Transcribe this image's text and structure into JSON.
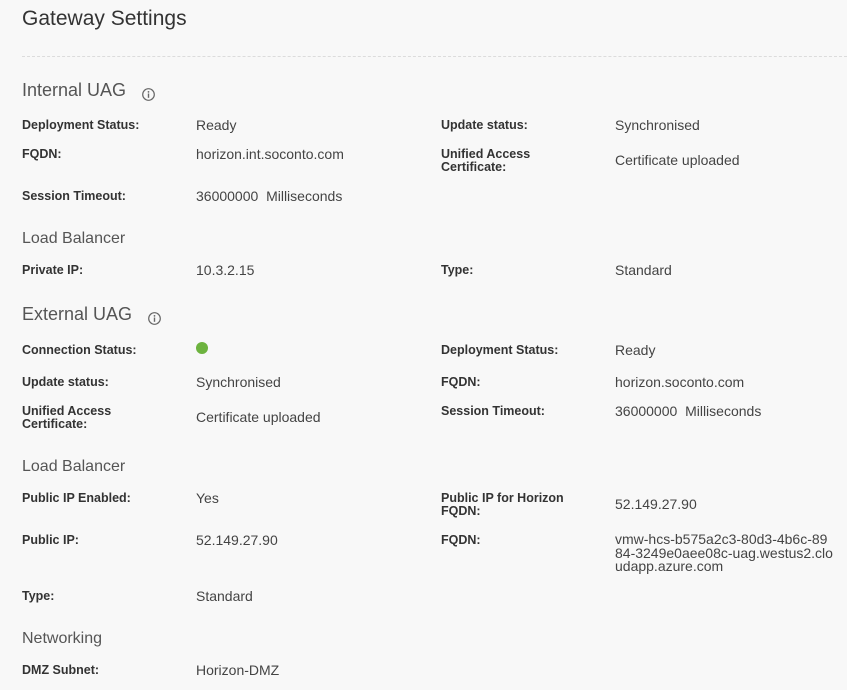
{
  "page": {
    "title": "Gateway Settings"
  },
  "internal": {
    "title": "Internal UAG",
    "deployment_status_label": "Deployment Status:",
    "deployment_status": "Ready",
    "update_status_label": "Update status:",
    "update_status": "Synchronised",
    "fqdn_label": "FQDN:",
    "fqdn": "horizon.int.soconto.com",
    "uac_label": "Unified Access Certificate:",
    "uac": "Certificate uploaded",
    "session_timeout_label": "Session Timeout:",
    "session_timeout": "36000000  Milliseconds",
    "lb": {
      "title": "Load Balancer",
      "private_ip_label": "Private IP:",
      "private_ip": "10.3.2.15",
      "type_label": "Type:",
      "type": "Standard"
    }
  },
  "external": {
    "title": "External UAG",
    "connection_status_label": "Connection Status:",
    "connection_status_color": "#6db33f",
    "deployment_status_label": "Deployment Status:",
    "deployment_status": "Ready",
    "update_status_label": "Update status:",
    "update_status": "Synchronised",
    "fqdn_label": "FQDN:",
    "fqdn": "horizon.soconto.com",
    "uac_label": "Unified Access Certificate:",
    "uac": "Certificate uploaded",
    "session_timeout_label": "Session Timeout:",
    "session_timeout": "36000000  Milliseconds",
    "lb": {
      "title": "Load Balancer",
      "public_ip_enabled_label": "Public IP Enabled:",
      "public_ip_enabled": "Yes",
      "public_ip_horizon_label": "Public IP for Horizon FQDN:",
      "public_ip_horizon": "52.149.27.90",
      "public_ip_label": "Public IP:",
      "public_ip": "52.149.27.90",
      "fqdn_label": "FQDN:",
      "fqdn": "vmw-hcs-b575a2c3-80d3-4b6c-8984-3249e0aee08c-uag.westus2.cloudapp.azure.com",
      "type_label": "Type:",
      "type": "Standard"
    }
  },
  "networking": {
    "title": "Networking",
    "dmz_subnet_label": "DMZ Subnet:",
    "dmz_subnet": "Horizon-DMZ"
  },
  "icons": {
    "info": "info-icon",
    "status_dot": "status-dot-icon"
  }
}
